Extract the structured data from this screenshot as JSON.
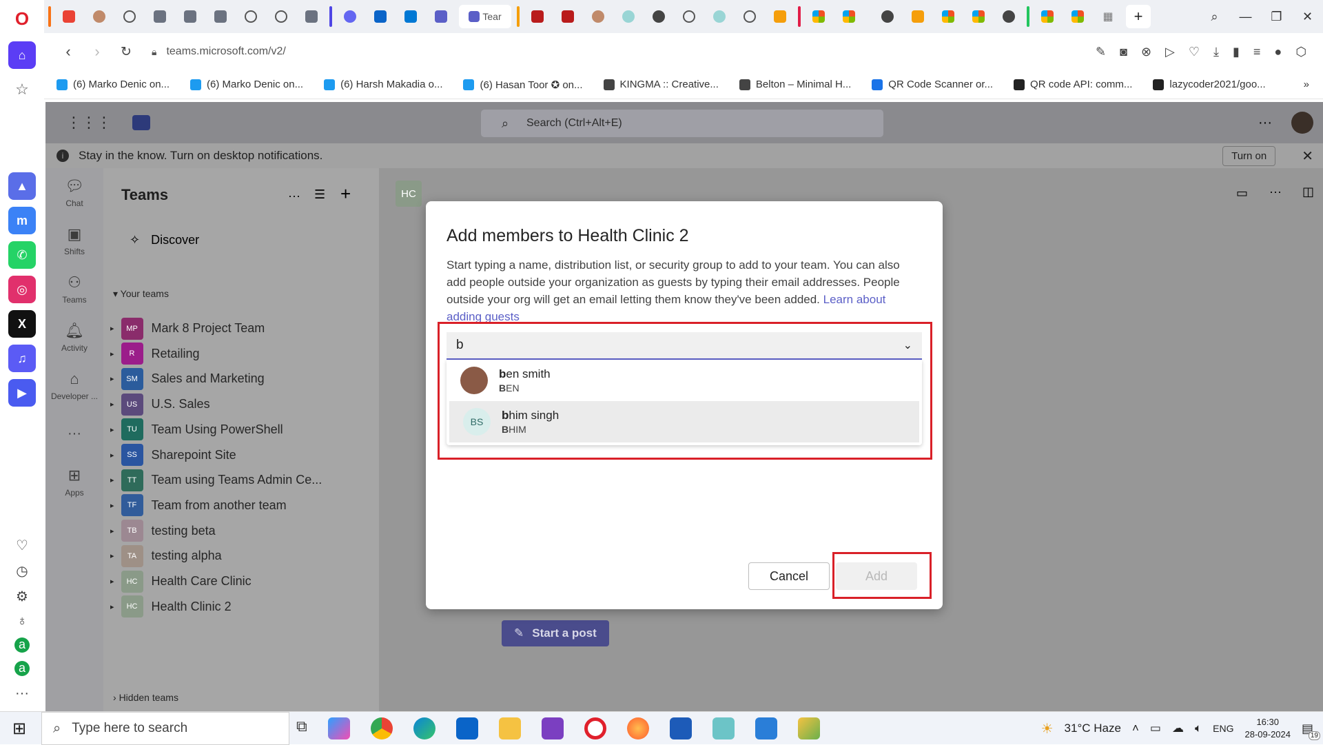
{
  "browser": {
    "url": "teams.microsoft.com/v2/",
    "active_tab_label": "Tear",
    "bookmarks": [
      {
        "label": "(6) Marko Denic on...",
        "color": "#1d9bf0"
      },
      {
        "label": "(6) Marko Denic on...",
        "color": "#1d9bf0"
      },
      {
        "label": "(6) Harsh Makadia o...",
        "color": "#1d9bf0"
      },
      {
        "label": "(6) Hasan Toor ✪ on...",
        "color": "#1d9bf0"
      },
      {
        "label": "KINGMA :: Creative...",
        "color": "#444444"
      },
      {
        "label": "Belton – Minimal H...",
        "color": "#444444"
      },
      {
        "label": "QR Code Scanner or...",
        "color": "#1a73e8"
      },
      {
        "label": "QR code API: comm...",
        "color": "#222222"
      },
      {
        "label": "lazycoder2021/goo...",
        "color": "#222222"
      }
    ]
  },
  "teams": {
    "search_placeholder": "Search (Ctrl+Alt+E)",
    "notification": "Stay in the know. Turn on desktop notifications.",
    "turn_on": "Turn on",
    "rail": [
      "Chat",
      "Shifts",
      "Teams",
      "Activity",
      "Developer ...",
      "Apps"
    ],
    "panel_title": "Teams",
    "discover": "Discover",
    "your_teams": "Your teams",
    "team_list": [
      {
        "abbr": "MP",
        "name": "Mark 8 Project Team",
        "color": "#8a2c6b"
      },
      {
        "abbr": "R",
        "name": "Retailing",
        "color": "#9b1d8a"
      },
      {
        "abbr": "SM",
        "name": "Sales and Marketing",
        "color": "#2b5c9c"
      },
      {
        "abbr": "US",
        "name": "U.S. Sales",
        "color": "#5b4a7c"
      },
      {
        "abbr": "TU",
        "name": "Team Using PowerShell",
        "color": "#1f6b5e"
      },
      {
        "abbr": "SS",
        "name": "Sharepoint Site",
        "color": "#2a55a0"
      },
      {
        "abbr": "TT",
        "name": "Team using Teams Admin Ce...",
        "color": "#2f6b5a"
      },
      {
        "abbr": "TF",
        "name": "Team from another team",
        "color": "#315c9a"
      },
      {
        "abbr": "TB",
        "name": "testing beta",
        "color": "#9c8892"
      },
      {
        "abbr": "TA",
        "name": "testing alpha",
        "color": "#9e9086"
      },
      {
        "abbr": "HC",
        "name": "Health Care Clinic",
        "color": "#8a9a88"
      },
      {
        "abbr": "HC",
        "name": "Health Clinic 2",
        "color": "#8a9a88"
      }
    ],
    "hidden_teams": "Hidden teams",
    "channel_badge": "HC",
    "start_post": "Start a post"
  },
  "modal": {
    "title": "Add members to Health Clinic 2",
    "description": "Start typing a name, distribution list, or security group to add to your team. You can also add people outside your organization as guests by typing their email addresses. People outside your org will get an email letting them know they've been added.",
    "learn_link": "Learn about adding guests",
    "input_value": "b",
    "options": [
      {
        "match": "b",
        "name_rest": "en smith",
        "sub_match": "B",
        "sub_rest": "EN",
        "initials": ""
      },
      {
        "match": "b",
        "name_rest": "him singh",
        "sub_match": "B",
        "sub_rest": "HIM",
        "initials": "BS"
      }
    ],
    "cancel": "Cancel",
    "add": "Add"
  },
  "taskbar": {
    "search_placeholder": "Type here to search",
    "weather": "31°C Haze",
    "lang": "ENG",
    "time": "16:30",
    "date": "28-09-2024",
    "notif_count": "19"
  }
}
